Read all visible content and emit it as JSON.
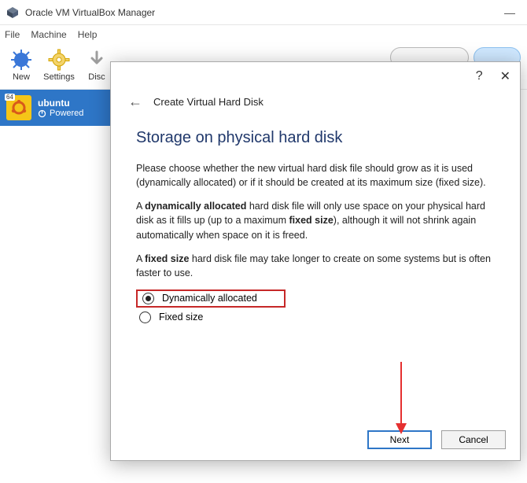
{
  "window": {
    "title": "Oracle VM VirtualBox Manager",
    "menus": {
      "file": "File",
      "machine": "Machine",
      "help": "Help"
    },
    "toolbar": {
      "new": "New",
      "settings": "Settings",
      "discard": "Disc"
    }
  },
  "vm": {
    "badge_tag": "64",
    "name": "ubuntu",
    "state": "Powered"
  },
  "dialog": {
    "help_glyph": "?",
    "close_glyph": "✕",
    "back_glyph": "←",
    "title": "Create Virtual Hard Disk",
    "heading": "Storage on physical hard disk",
    "p1": "Please choose whether the new virtual hard disk file should grow as it is used (dynamically allocated) or if it should be created at its maximum size (fixed size).",
    "p2_a": "A ",
    "p2_b": "dynamically allocated",
    "p2_c": " hard disk file will only use space on your physical hard disk as it fills up (up to a maximum ",
    "p2_d": "fixed size",
    "p2_e": "), although it will not shrink again automatically when space on it is freed.",
    "p3_a": "A ",
    "p3_b": "fixed size",
    "p3_c": " hard disk file may take longer to create on some systems but is often faster to use.",
    "opt_dynamic": "Dynamically allocated",
    "opt_fixed": "Fixed size",
    "btn_next": "Next",
    "btn_cancel": "Cancel"
  }
}
